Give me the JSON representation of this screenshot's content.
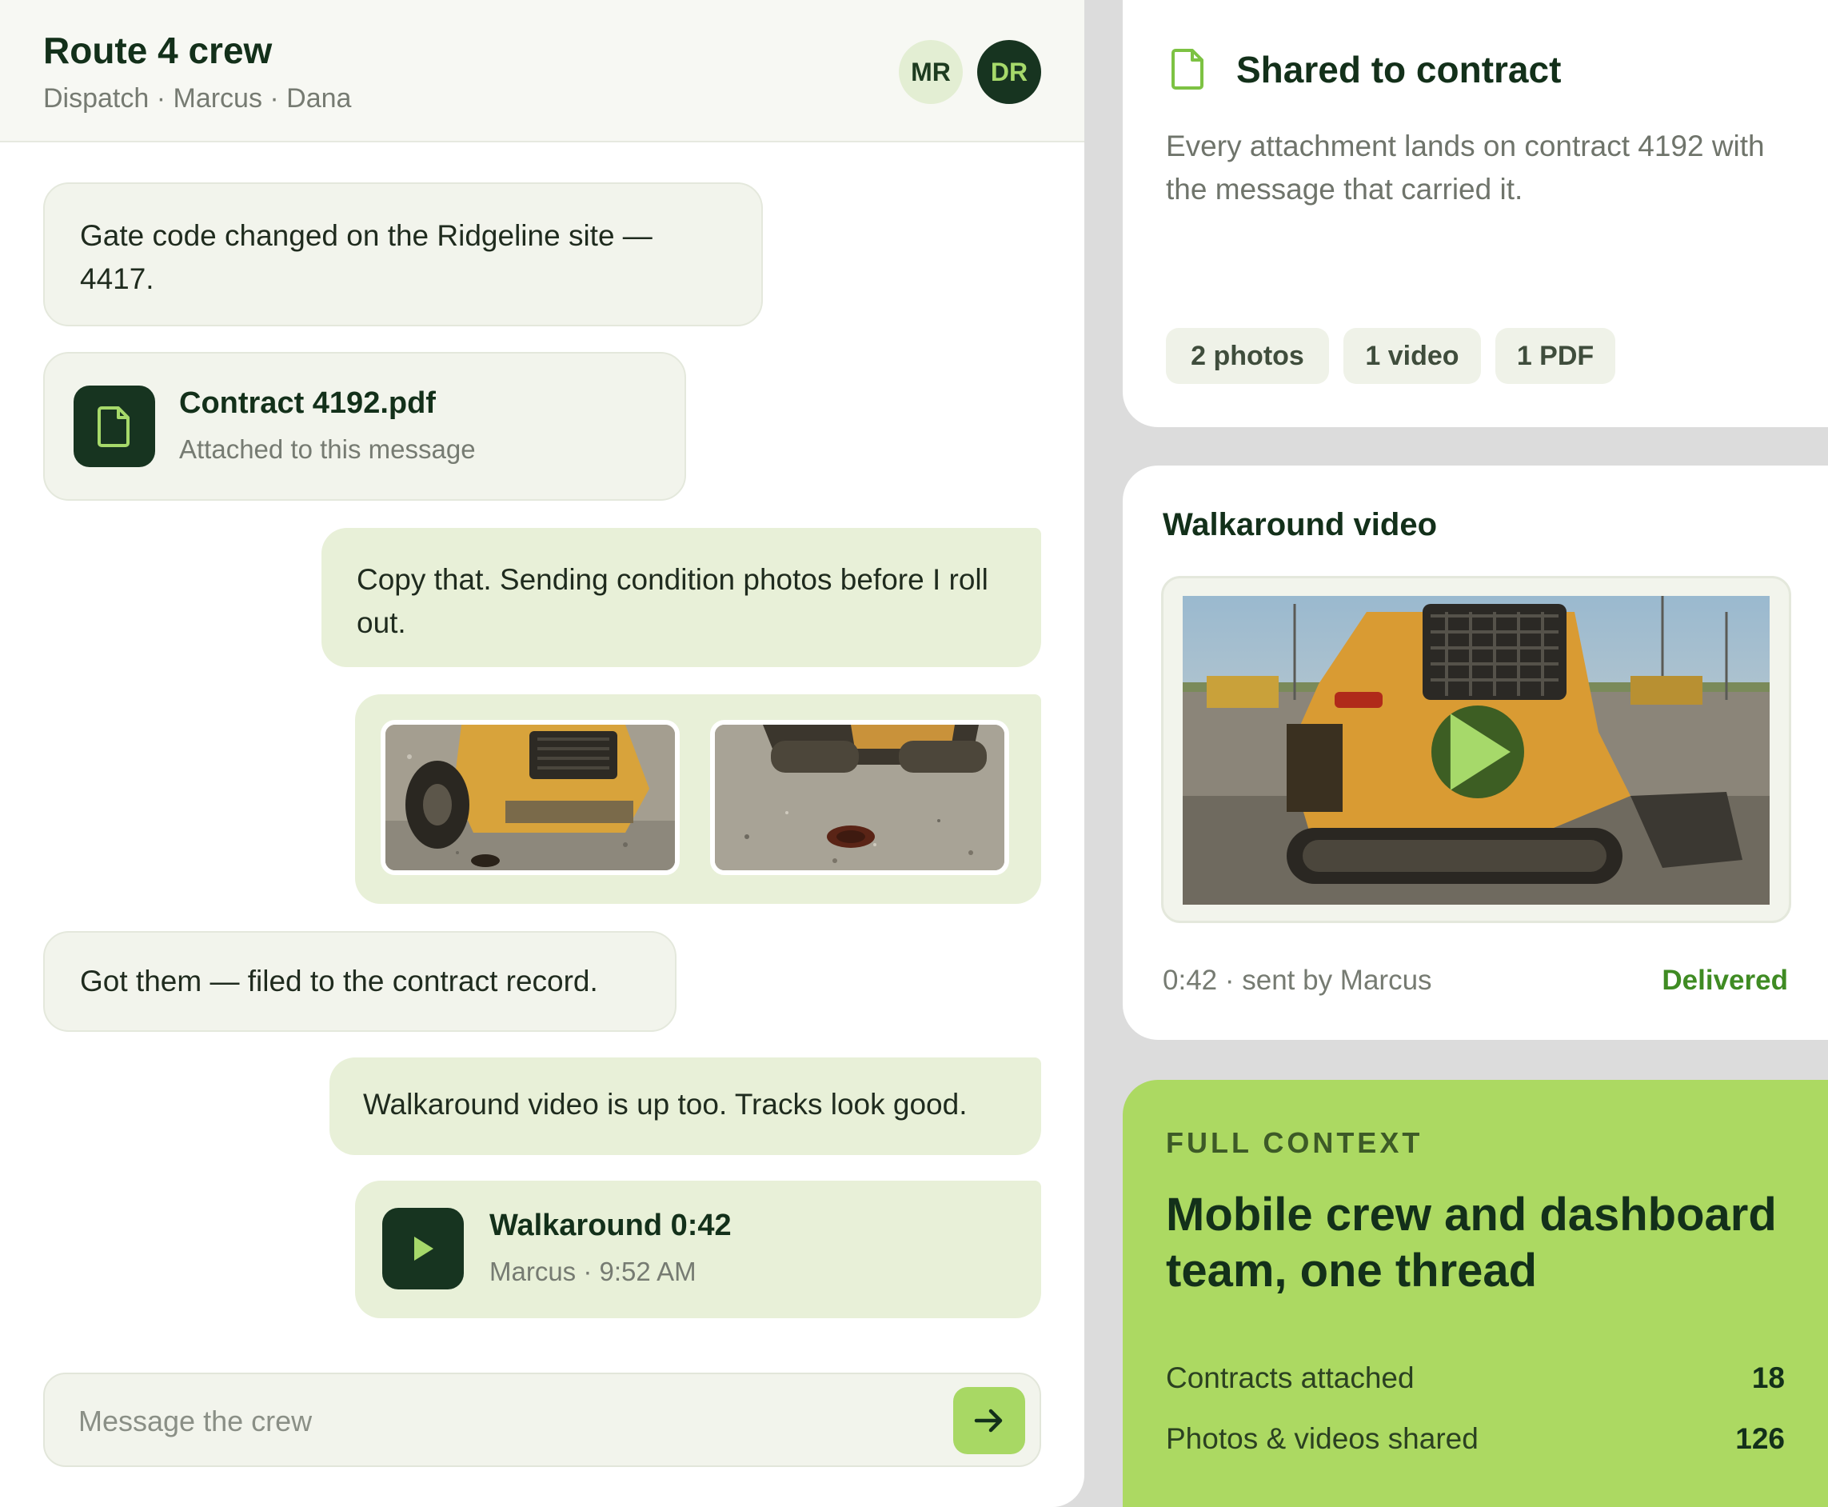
{
  "chat": {
    "title": "Route 4 crew",
    "subtitle": "Dispatch · Marcus · Dana",
    "avatars": [
      "MR",
      "DR"
    ],
    "messages": {
      "m1": "Gate code changed on the Ridgeline site — 4417.",
      "file": {
        "name": "Contract 4192.pdf",
        "sub": "Attached to this message"
      },
      "m3": "Copy that. Sending condition photos before I roll out.",
      "m5": "Got them — filed to the contract record.",
      "m6": "Walkaround video is up too. Tracks look good.",
      "video": {
        "title": "Walkaround 0:42",
        "sub": "Marcus · 9:52 AM"
      }
    },
    "composer_placeholder": "Message the crew"
  },
  "shared": {
    "title": "Shared to contract",
    "description": "Every attachment lands on contract 4192 with the message that carried it.",
    "chips": [
      "2 photos",
      "1 video",
      "1 PDF"
    ]
  },
  "walkaround": {
    "title": "Walkaround video",
    "meta": "0:42 · sent by Marcus",
    "status": "Delivered"
  },
  "context": {
    "label": "FULL CONTEXT",
    "heading": "Mobile crew and dashboard team, one thread",
    "stats": [
      {
        "label": "Contracts attached",
        "value": "18"
      },
      {
        "label": "Photos & videos shared",
        "value": "126"
      }
    ]
  },
  "colors": {
    "accent_green": "#acd962",
    "dark_green": "#173420",
    "delivered_green": "#3f8b23"
  },
  "icons": [
    "document-icon",
    "play-icon",
    "arrow-right-icon"
  ]
}
